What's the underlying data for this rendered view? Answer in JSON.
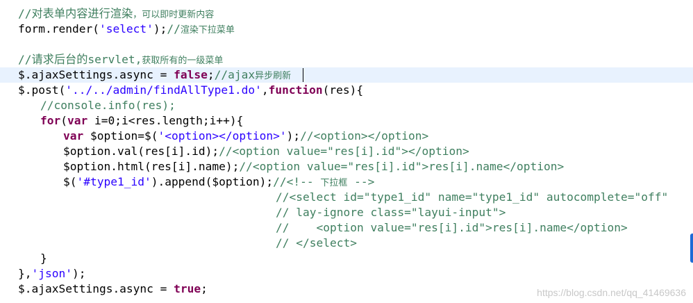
{
  "code_lines": [
    {
      "indent": "    ",
      "current": false,
      "tokens": [
        [
          "c",
          "//对表单内容进行渲染"
        ],
        [
          "c cjk",
          "，可以即时更新内容"
        ]
      ]
    },
    {
      "indent": "    ",
      "current": false,
      "tokens": [
        [
          "p",
          "form.render("
        ],
        [
          "s",
          "'select'"
        ],
        [
          "p",
          ");"
        ],
        [
          "c",
          "//"
        ],
        [
          "c cjk",
          "渲染下拉菜单"
        ]
      ]
    },
    {
      "indent": "",
      "current": false,
      "tokens": []
    },
    {
      "indent": "    ",
      "current": false,
      "tokens": [
        [
          "c",
          "//请求后台的servlet,"
        ],
        [
          "c cjk",
          "获取所有的一级菜单"
        ]
      ]
    },
    {
      "indent": "    ",
      "current": true,
      "tokens": [
        [
          "p",
          "$.ajaxSettings.async = "
        ],
        [
          "k",
          "false"
        ],
        [
          "p",
          ";"
        ],
        [
          "c",
          "//ajax"
        ],
        [
          "c cjk",
          "异步刷新"
        ]
      ]
    },
    {
      "indent": "    ",
      "current": false,
      "tokens": [
        [
          "p",
          "$.post("
        ],
        [
          "s",
          "'../../admin/findAllType1.do'"
        ],
        [
          "p",
          ","
        ],
        [
          "k",
          "function"
        ],
        [
          "p",
          "(res){"
        ]
      ]
    },
    {
      "indent": "        ",
      "current": false,
      "tokens": [
        [
          "c",
          "//console.info(res);"
        ]
      ]
    },
    {
      "indent": "        ",
      "current": false,
      "tokens": [
        [
          "k",
          "for"
        ],
        [
          "p",
          "("
        ],
        [
          "k",
          "var"
        ],
        [
          "p",
          " i=0;i<res.length;i++){"
        ]
      ]
    },
    {
      "indent": "            ",
      "current": false,
      "tokens": [
        [
          "k",
          "var"
        ],
        [
          "p",
          " $option=$("
        ],
        [
          "s",
          "'<option></option>'"
        ],
        [
          "p",
          ");"
        ],
        [
          "c",
          "//<option></option>"
        ]
      ]
    },
    {
      "indent": "            ",
      "current": false,
      "tokens": [
        [
          "p",
          "$option.val(res[i].id);"
        ],
        [
          "c",
          "//<option value=\"res[i].id\"></option>"
        ]
      ]
    },
    {
      "indent": "            ",
      "current": false,
      "tokens": [
        [
          "p",
          "$option.html(res[i].name);"
        ],
        [
          "c",
          "//<option value=\"res[i].id\">res[i].name</option>"
        ]
      ]
    },
    {
      "indent": "            ",
      "current": false,
      "tokens": [
        [
          "p",
          "$("
        ],
        [
          "s",
          "'#type1_id'"
        ],
        [
          "p",
          ").append($option);"
        ],
        [
          "c",
          "//<!-- "
        ],
        [
          "c cjk",
          "下拉框"
        ],
        [
          "c",
          " -->"
        ]
      ]
    },
    {
      "indent": "                                                  ",
      "current": false,
      "tokens": [
        [
          "c",
          "//<select id=\"type1_id\" name=\"type1_id\" autocomplete=\"off\""
        ]
      ]
    },
    {
      "indent": "                                                  ",
      "current": false,
      "tokens": [
        [
          "c",
          "// lay-ignore class=\"layui-input\">"
        ]
      ]
    },
    {
      "indent": "                                                  ",
      "current": false,
      "tokens": [
        [
          "c",
          "//    <option value=\"res[i].id\">res[i].name</option>"
        ]
      ]
    },
    {
      "indent": "                                                  ",
      "current": false,
      "tokens": [
        [
          "c",
          "// </select>"
        ]
      ]
    },
    {
      "indent": "        ",
      "current": false,
      "tokens": [
        [
          "p",
          "}"
        ]
      ]
    },
    {
      "indent": "    ",
      "current": false,
      "tokens": [
        [
          "p",
          "},"
        ],
        [
          "s",
          "'json'"
        ],
        [
          "p",
          ");"
        ]
      ]
    },
    {
      "indent": "    ",
      "current": false,
      "tokens": [
        [
          "p",
          "$.ajaxSettings.async = "
        ],
        [
          "k",
          "true"
        ],
        [
          "p",
          ";"
        ]
      ]
    }
  ],
  "watermark": "https://blog.csdn.net/qq_41469636"
}
